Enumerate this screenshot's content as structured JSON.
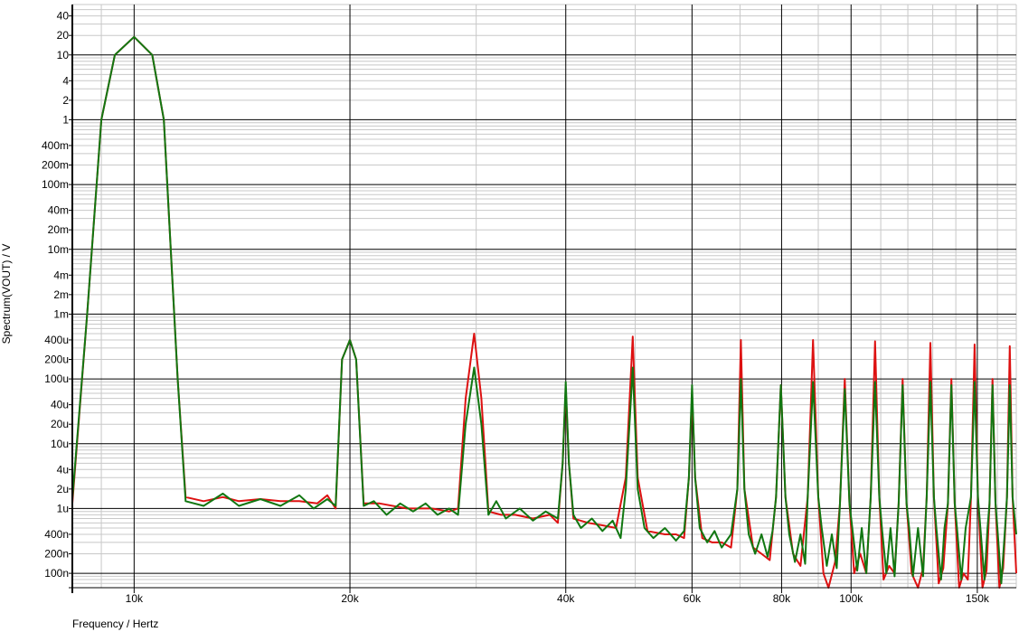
{
  "chart_data": {
    "type": "line",
    "title": "",
    "xlabel": "Frequency / Hertz",
    "ylabel": "Spectrum(VOUT) / V",
    "x_scale": "log",
    "y_scale": "log",
    "xlim": [
      8200,
      170000
    ],
    "ylim": [
      6e-08,
      60
    ],
    "grid": true,
    "legend": "none",
    "x_tick_labels": [
      {
        "v": 10000,
        "label": "10k"
      },
      {
        "v": 20000,
        "label": "20k"
      },
      {
        "v": 40000,
        "label": "40k"
      },
      {
        "v": 60000,
        "label": "60k"
      },
      {
        "v": 80000,
        "label": "80k"
      },
      {
        "v": 100000,
        "label": "100k"
      },
      {
        "v": 150000,
        "label": "150k"
      }
    ],
    "y_tick_labels": [
      {
        "v": 40,
        "label": "40"
      },
      {
        "v": 20,
        "label": "20"
      },
      {
        "v": 10,
        "label": "10"
      },
      {
        "v": 4,
        "label": "4"
      },
      {
        "v": 2,
        "label": "2"
      },
      {
        "v": 1,
        "label": "1"
      },
      {
        "v": 0.4,
        "label": "400m"
      },
      {
        "v": 0.2,
        "label": "200m"
      },
      {
        "v": 0.1,
        "label": "100m"
      },
      {
        "v": 0.04,
        "label": "40m"
      },
      {
        "v": 0.02,
        "label": "20m"
      },
      {
        "v": 0.01,
        "label": "10m"
      },
      {
        "v": 0.004,
        "label": "4m"
      },
      {
        "v": 0.002,
        "label": "2m"
      },
      {
        "v": 0.001,
        "label": "1m"
      },
      {
        "v": 0.0004,
        "label": "400u"
      },
      {
        "v": 0.0002,
        "label": "200u"
      },
      {
        "v": 0.0001,
        "label": "100u"
      },
      {
        "v": 4e-05,
        "label": "40u"
      },
      {
        "v": 2e-05,
        "label": "20u"
      },
      {
        "v": 1e-05,
        "label": "10u"
      },
      {
        "v": 4e-06,
        "label": "4u"
      },
      {
        "v": 2e-06,
        "label": "2u"
      },
      {
        "v": 1e-06,
        "label": "1u"
      },
      {
        "v": 4e-07,
        "label": "400n"
      },
      {
        "v": 2e-07,
        "label": "200n"
      },
      {
        "v": 1e-07,
        "label": "100n"
      }
    ],
    "series": [
      {
        "color": "#dd1111",
        "points": [
          [
            8200,
            1.2e-06
          ],
          [
            8600,
            0.001
          ],
          [
            9000,
            1.0
          ],
          [
            9400,
            10
          ],
          [
            10000,
            19
          ],
          [
            10600,
            10
          ],
          [
            11000,
            1.0
          ],
          [
            11500,
            0.0001
          ],
          [
            11800,
            1.5e-06
          ],
          [
            12500,
            1.3e-06
          ],
          [
            13300,
            1.5e-06
          ],
          [
            14000,
            1.3e-06
          ],
          [
            15000,
            1.4e-06
          ],
          [
            16000,
            1.3e-06
          ],
          [
            17000,
            1.3e-06
          ],
          [
            18000,
            1.2e-06
          ],
          [
            18600,
            1.6e-06
          ],
          [
            19100,
            1e-06
          ],
          [
            19500,
            0.0002
          ],
          [
            20000,
            0.0004
          ],
          [
            20400,
            0.0002
          ],
          [
            20900,
            1.2e-06
          ],
          [
            22000,
            1.2e-06
          ],
          [
            24000,
            1e-06
          ],
          [
            26000,
            1e-06
          ],
          [
            27500,
            9e-07
          ],
          [
            28300,
            1e-06
          ],
          [
            29000,
            5e-05
          ],
          [
            29800,
            0.0005
          ],
          [
            30500,
            5e-05
          ],
          [
            31200,
            9e-07
          ],
          [
            32500,
            8e-07
          ],
          [
            34000,
            8e-07
          ],
          [
            36000,
            7e-07
          ],
          [
            38000,
            8e-07
          ],
          [
            39000,
            6e-07
          ],
          [
            39600,
            5e-06
          ],
          [
            40000,
            7e-05
          ],
          [
            40400,
            5e-06
          ],
          [
            41000,
            7e-07
          ],
          [
            43000,
            6e-07
          ],
          [
            45000,
            5.5e-07
          ],
          [
            47000,
            5e-07
          ],
          [
            48500,
            3e-06
          ],
          [
            49600,
            0.00045
          ],
          [
            50400,
            3e-06
          ],
          [
            52000,
            4.5e-07
          ],
          [
            55000,
            4e-07
          ],
          [
            57000,
            4e-07
          ],
          [
            58500,
            3.5e-07
          ],
          [
            59400,
            3e-06
          ],
          [
            60000,
            6e-05
          ],
          [
            60600,
            3e-06
          ],
          [
            62000,
            3.5e-07
          ],
          [
            64000,
            3e-07
          ],
          [
            66000,
            3e-07
          ],
          [
            68000,
            2.5e-07
          ],
          [
            69400,
            2e-06
          ],
          [
            70200,
            0.0004
          ],
          [
            71000,
            2e-06
          ],
          [
            73000,
            2.5e-07
          ],
          [
            75000,
            2e-07
          ],
          [
            77000,
            1.6e-07
          ],
          [
            78600,
            1.5e-06
          ],
          [
            79800,
            8e-05
          ],
          [
            81000,
            1.5e-06
          ],
          [
            83000,
            2e-07
          ],
          [
            85000,
            1.3e-07
          ],
          [
            87000,
            1.5e-06
          ],
          [
            88500,
            0.0004
          ],
          [
            90000,
            1.5e-06
          ],
          [
            91500,
            1e-07
          ],
          [
            93000,
            6e-08
          ],
          [
            95000,
            1.5e-07
          ],
          [
            96500,
            1.2e-06
          ],
          [
            98000,
            0.0001
          ],
          [
            99500,
            1.2e-06
          ],
          [
            101000,
            1e-07
          ],
          [
            103000,
            2e-07
          ],
          [
            105000,
            1e-07
          ],
          [
            106500,
            1.5e-06
          ],
          [
            108000,
            0.00038
          ],
          [
            109500,
            1.5e-06
          ],
          [
            111000,
            8e-08
          ],
          [
            113000,
            1.3e-07
          ],
          [
            115000,
            1e-07
          ],
          [
            116500,
            1.2e-06
          ],
          [
            118000,
            0.0001
          ],
          [
            119500,
            1.2e-06
          ],
          [
            121500,
            1e-07
          ],
          [
            124000,
            6e-08
          ],
          [
            126000,
            1.2e-07
          ],
          [
            127500,
            1.5e-06
          ],
          [
            129000,
            0.00036
          ],
          [
            130500,
            1.5e-06
          ],
          [
            132500,
            7e-08
          ],
          [
            134500,
            1.2e-07
          ],
          [
            136500,
            1.2e-06
          ],
          [
            138000,
            0.0001
          ],
          [
            139500,
            1.2e-06
          ],
          [
            141500,
            6e-08
          ],
          [
            143500,
            1e-07
          ],
          [
            145500,
            8e-08
          ],
          [
            147000,
            1.5e-06
          ],
          [
            148700,
            0.00034
          ],
          [
            150300,
            1.5e-06
          ],
          [
            152500,
            6e-08
          ],
          [
            154500,
            1.1e-07
          ],
          [
            156000,
            1.2e-06
          ],
          [
            157500,
            0.0001
          ],
          [
            159000,
            1.2e-06
          ],
          [
            161000,
            6e-08
          ],
          [
            163000,
            1.2e-07
          ],
          [
            165000,
            1.5e-06
          ],
          [
            166500,
            0.00032
          ],
          [
            168000,
            1.5e-06
          ],
          [
            170000,
            1e-07
          ]
        ]
      },
      {
        "color": "#117711",
        "points": [
          [
            8200,
            1.4e-06
          ],
          [
            8600,
            0.001
          ],
          [
            9000,
            1.0
          ],
          [
            9400,
            10
          ],
          [
            10000,
            19
          ],
          [
            10600,
            10
          ],
          [
            11000,
            1.0
          ],
          [
            11500,
            0.0001
          ],
          [
            11800,
            1.3e-06
          ],
          [
            12500,
            1.1e-06
          ],
          [
            13300,
            1.7e-06
          ],
          [
            14000,
            1.1e-06
          ],
          [
            15000,
            1.4e-06
          ],
          [
            16000,
            1.1e-06
          ],
          [
            17000,
            1.6e-06
          ],
          [
            17800,
            1e-06
          ],
          [
            18600,
            1.4e-06
          ],
          [
            19100,
            1.1e-06
          ],
          [
            19500,
            0.0002
          ],
          [
            20000,
            0.0004
          ],
          [
            20400,
            0.0002
          ],
          [
            20900,
            1.1e-06
          ],
          [
            21600,
            1.3e-06
          ],
          [
            22500,
            8e-07
          ],
          [
            23500,
            1.2e-06
          ],
          [
            24500,
            9e-07
          ],
          [
            25500,
            1.2e-06
          ],
          [
            26500,
            8e-07
          ],
          [
            27500,
            1e-06
          ],
          [
            28300,
            8e-07
          ],
          [
            29000,
            2e-05
          ],
          [
            29800,
            0.00015
          ],
          [
            30500,
            2e-05
          ],
          [
            31200,
            8e-07
          ],
          [
            32000,
            1.3e-06
          ],
          [
            33000,
            7e-07
          ],
          [
            34500,
            1e-06
          ],
          [
            36000,
            6.5e-07
          ],
          [
            37500,
            9e-07
          ],
          [
            39000,
            7e-07
          ],
          [
            39600,
            5e-06
          ],
          [
            40000,
            9e-05
          ],
          [
            40400,
            5e-06
          ],
          [
            41000,
            8e-07
          ],
          [
            42000,
            5e-07
          ],
          [
            43500,
            7e-07
          ],
          [
            45000,
            4.5e-07
          ],
          [
            46500,
            6.5e-07
          ],
          [
            47700,
            3.5e-07
          ],
          [
            48500,
            2e-06
          ],
          [
            49600,
            0.00015
          ],
          [
            50400,
            2e-06
          ],
          [
            51500,
            5e-07
          ],
          [
            53000,
            3.5e-07
          ],
          [
            55000,
            5e-07
          ],
          [
            57000,
            3.2e-07
          ],
          [
            58500,
            4.5e-07
          ],
          [
            59400,
            3e-06
          ],
          [
            60000,
            8e-05
          ],
          [
            60600,
            3e-06
          ],
          [
            61500,
            5e-07
          ],
          [
            63000,
            3e-07
          ],
          [
            64500,
            4.5e-07
          ],
          [
            66000,
            2.5e-07
          ],
          [
            68000,
            4e-07
          ],
          [
            69400,
            2e-06
          ],
          [
            70200,
            0.0001
          ],
          [
            71000,
            2e-06
          ],
          [
            72000,
            4e-07
          ],
          [
            73500,
            2e-07
          ],
          [
            75000,
            4e-07
          ],
          [
            76500,
            1.8e-07
          ],
          [
            77700,
            4.5e-07
          ],
          [
            78600,
            1.5e-06
          ],
          [
            79800,
            8e-05
          ],
          [
            81000,
            1.5e-06
          ],
          [
            82000,
            4e-07
          ],
          [
            83500,
            1.5e-07
          ],
          [
            85000,
            4e-07
          ],
          [
            86300,
            1.4e-07
          ],
          [
            87000,
            1.5e-06
          ],
          [
            88500,
            9e-05
          ],
          [
            90000,
            1.5e-06
          ],
          [
            91000,
            5e-07
          ],
          [
            92500,
            1.3e-07
          ],
          [
            94000,
            4e-07
          ],
          [
            95500,
            1.2e-07
          ],
          [
            96500,
            1.2e-06
          ],
          [
            98000,
            7e-05
          ],
          [
            99500,
            1.2e-06
          ],
          [
            100500,
            4.5e-07
          ],
          [
            102000,
            1.1e-07
          ],
          [
            103500,
            5e-07
          ],
          [
            105000,
            1e-07
          ],
          [
            106500,
            1.5e-06
          ],
          [
            108000,
            9e-05
          ],
          [
            109500,
            1.5e-06
          ],
          [
            110500,
            4.5e-07
          ],
          [
            112000,
            1e-07
          ],
          [
            113500,
            5e-07
          ],
          [
            115000,
            9e-08
          ],
          [
            116500,
            1.2e-06
          ],
          [
            118000,
            8e-05
          ],
          [
            119500,
            1.2e-06
          ],
          [
            120500,
            5e-07
          ],
          [
            122000,
            9e-08
          ],
          [
            124000,
            5e-07
          ],
          [
            126000,
            9e-08
          ],
          [
            127500,
            1.5e-06
          ],
          [
            129000,
            9e-05
          ],
          [
            130500,
            1.5e-06
          ],
          [
            131500,
            5e-07
          ],
          [
            133500,
            8e-08
          ],
          [
            135000,
            5e-07
          ],
          [
            136500,
            1.2e-06
          ],
          [
            138000,
            8e-05
          ],
          [
            139500,
            1.2e-06
          ],
          [
            140500,
            5e-07
          ],
          [
            142500,
            8e-08
          ],
          [
            144500,
            5e-07
          ],
          [
            147000,
            1.5e-06
          ],
          [
            148700,
            9e-05
          ],
          [
            150300,
            1.5e-06
          ],
          [
            151500,
            5e-07
          ],
          [
            153500,
            8e-08
          ],
          [
            155000,
            5e-07
          ],
          [
            156000,
            1.2e-06
          ],
          [
            157500,
            8e-05
          ],
          [
            159000,
            1.2e-06
          ],
          [
            160000,
            5e-07
          ],
          [
            162000,
            7e-08
          ],
          [
            164000,
            5e-07
          ],
          [
            165000,
            1.5e-06
          ],
          [
            166500,
            8e-05
          ],
          [
            168000,
            1.5e-06
          ],
          [
            170000,
            4e-07
          ]
        ]
      }
    ]
  }
}
